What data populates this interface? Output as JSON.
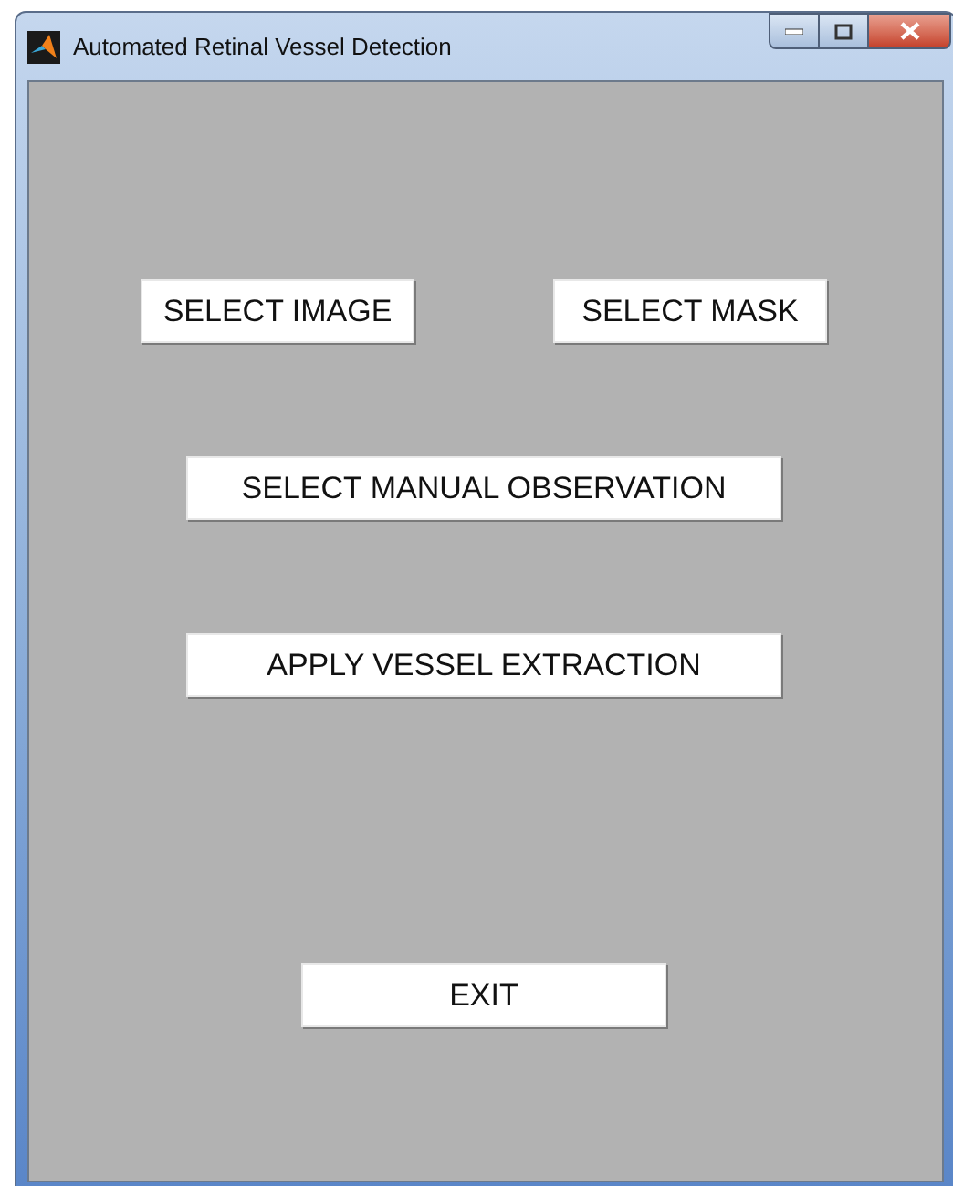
{
  "window": {
    "title": "Automated Retinal Vessel Detection"
  },
  "buttons": [
    {
      "label": "SELECT IMAGE"
    },
    {
      "label": "SELECT MASK"
    },
    {
      "label": "SELECT MANUAL OBSERVATION"
    },
    {
      "label": "APPLY VESSEL EXTRACTION"
    },
    {
      "label": "EXIT"
    }
  ]
}
